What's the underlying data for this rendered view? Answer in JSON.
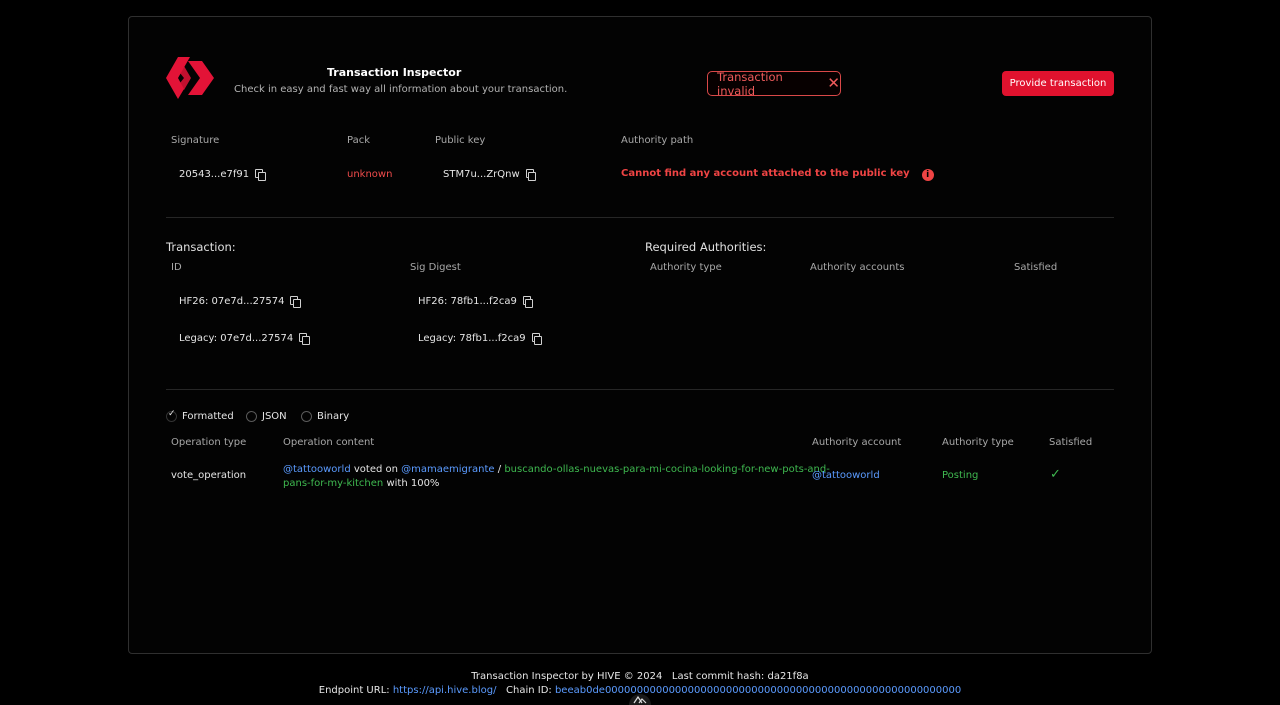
{
  "header": {
    "title": "Transaction Inspector",
    "subtitle": "Check in easy and fast way all information about your transaction.",
    "status_badge": "Transaction invalid",
    "close_icon": "close-icon",
    "provide_button": "Provide transaction",
    "brand_color": "#e0122e"
  },
  "signatures": {
    "columns": [
      "Signature",
      "Pack",
      "Public key",
      "Authority path"
    ],
    "row": {
      "signature": "20543...e7f91",
      "pack": "unknown",
      "public_key": "STM7u...ZrQnw",
      "authority_path": "Cannot find any account attached to the public key"
    }
  },
  "transaction": {
    "title": "Transaction:",
    "columns": [
      "ID",
      "Sig Digest"
    ],
    "id_hf26": "HF26: 07e7d...27574",
    "id_legacy": "Legacy: 07e7d...27574",
    "digest_hf26": "HF26: 78fb1...f2ca9",
    "digest_legacy": "Legacy: 78fb1...f2ca9"
  },
  "required_authorities": {
    "title": "Required Authorities:",
    "columns": [
      "Authority type",
      "Authority accounts",
      "Satisfied"
    ]
  },
  "view_modes": {
    "options": [
      "Formatted",
      "JSON",
      "Binary"
    ],
    "selected": "Formatted"
  },
  "operations": {
    "columns": [
      "Operation type",
      "Operation content",
      "Authority account",
      "Authority type",
      "Satisfied"
    ],
    "rows": [
      {
        "type": "vote_operation",
        "voter": "@tattooworld",
        "voted_on": "voted on",
        "author": "@mamaemigrante",
        "separator": "/",
        "permlink_line1": "buscando-ollas-nuevas-para-mi-cocina-looking-for-new-pots-and-",
        "permlink_line2": "pans-for-my-kitchen",
        "weight": "with 100%",
        "authority_account": "@tattooworld",
        "authority_type": "Posting",
        "satisfied": "✓"
      }
    ]
  },
  "footer": {
    "line1": "Transaction Inspector by HIVE © 2024   Last commit hash: da21f8a",
    "endpoint_label": "Endpoint URL:",
    "endpoint_url": "https://api.hive.blog/",
    "chain_label": "Chain ID:",
    "chain_id": "beeab0de00000000000000000000000000000000000000000000000000000000"
  }
}
